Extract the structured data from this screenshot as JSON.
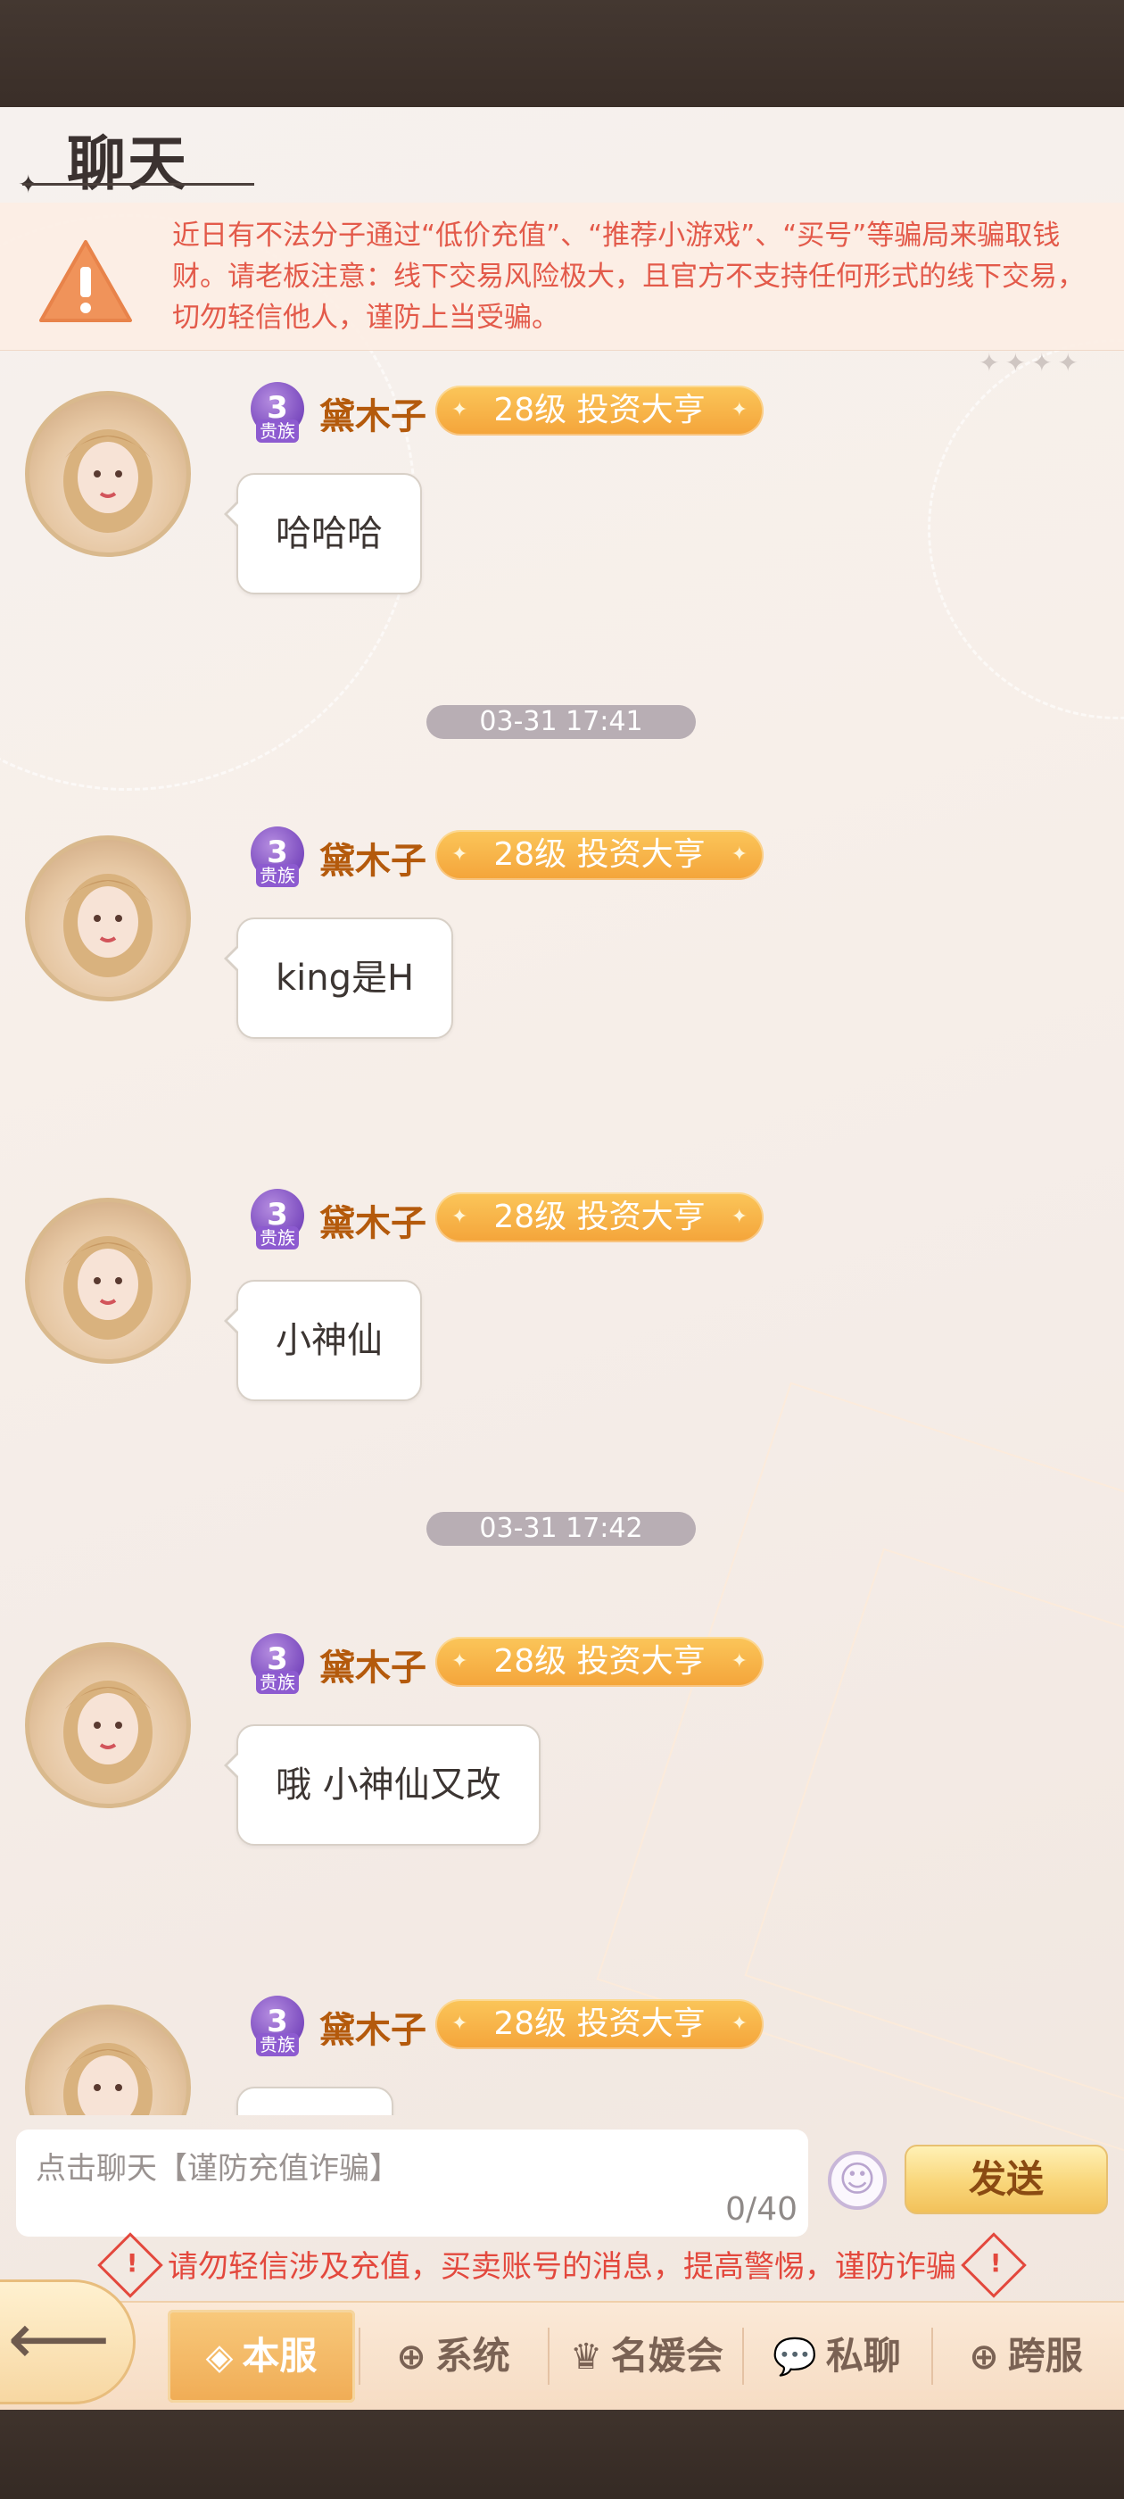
{
  "header": {
    "title": "聊天"
  },
  "warning": {
    "text": "近日有不法分子通过“低价充值”、“推荐小游戏”、“买号”等骗局来骗取钱财。请老板注意：线下交易风险极大，且官方不支持任何形式的线下交易，切勿轻信他人，谨防上当受骗。"
  },
  "messages": [
    {
      "badge_level": "3",
      "badge_label": "贵族",
      "name": "黛木子",
      "level_title": "28级 投资大亨",
      "text": "哈哈哈"
    },
    {
      "badge_level": "3",
      "badge_label": "贵族",
      "name": "黛木子",
      "level_title": "28级 投资大亨",
      "text": "king是H"
    },
    {
      "badge_level": "3",
      "badge_label": "贵族",
      "name": "黛木子",
      "level_title": "28级 投资大亨",
      "text": "小神仙"
    },
    {
      "badge_level": "3",
      "badge_label": "贵族",
      "name": "黛木子",
      "level_title": "28级 投资大亨",
      "text": "哦 小神仙又改"
    },
    {
      "badge_level": "3",
      "badge_label": "贵族",
      "name": "黛木子",
      "level_title": "28级 投资大亨",
      "text": ""
    }
  ],
  "timestamps": [
    "03-31 17:41",
    "03-31 17:42"
  ],
  "input": {
    "placeholder": "点击聊天【谨防充值诈骗】",
    "counter": "0/40"
  },
  "send_label": "发送",
  "tip": "请勿轻信涉及充值，买卖账号的消息，提高警惕，谨防诈骗",
  "tabs": [
    {
      "label": "本服",
      "icon": "diamond-icon"
    },
    {
      "label": "系统",
      "icon": "globe-icon"
    },
    {
      "label": "名媛会",
      "icon": "crown-icon"
    },
    {
      "label": "私聊",
      "icon": "chat-bubble-icon"
    },
    {
      "label": "跨服",
      "icon": "globe-icon"
    }
  ],
  "colors": {
    "accent": "#f4a43a",
    "warning": "#e35a4a",
    "name": "#b45a0c",
    "badge": "#7b4bbf"
  }
}
